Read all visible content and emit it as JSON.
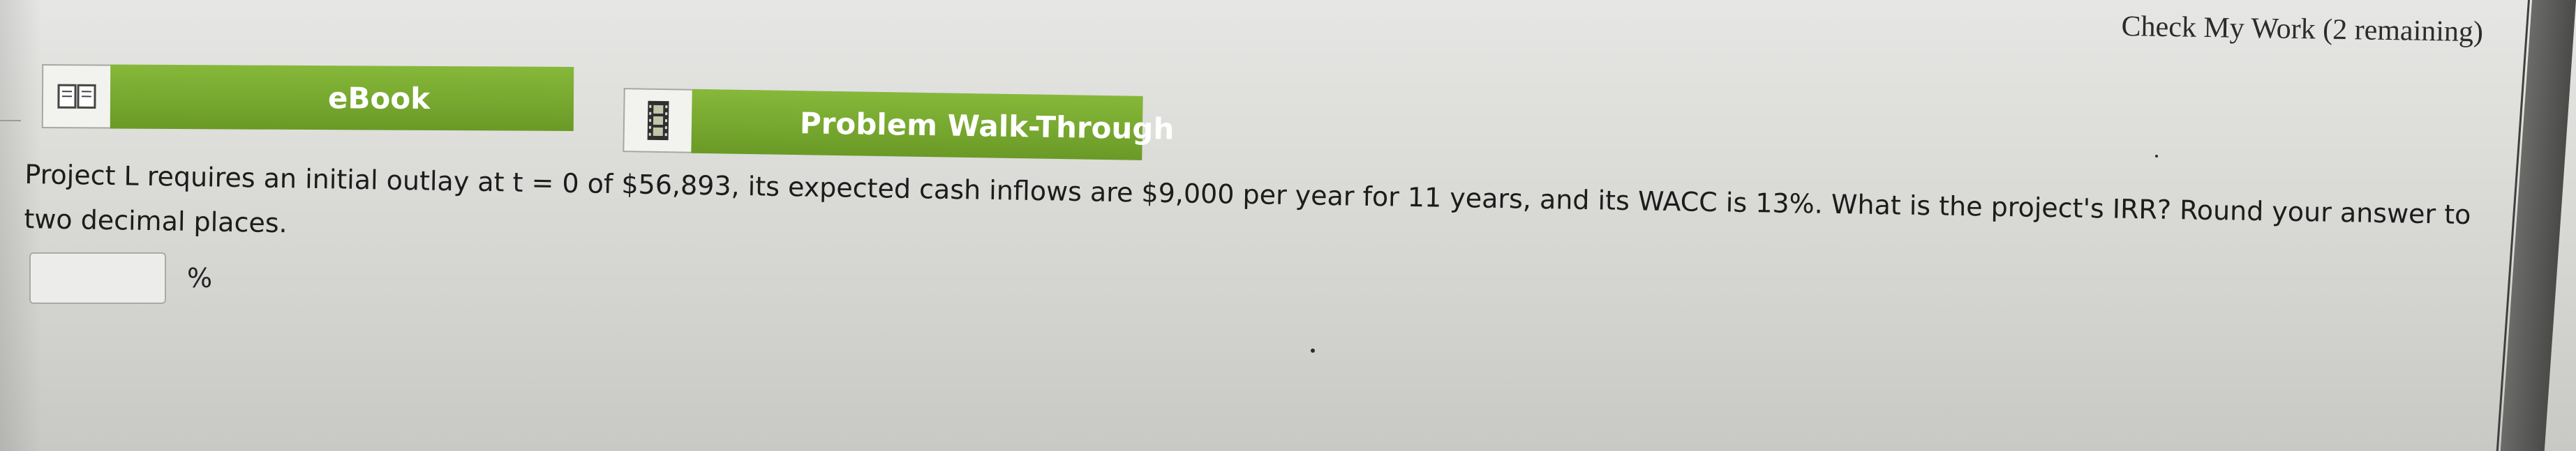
{
  "header": {
    "check_work_label": "Check My Work (2 remaining)"
  },
  "toolbar": {
    "ebook_label": "eBook",
    "ebook_icon": "book-icon",
    "walkthrough_label": "Problem Walk-Through",
    "walkthrough_icon": "film-strip-icon",
    "accent_color": "#78a82f"
  },
  "question": {
    "text": "Project L requires an initial outlay at t = 0 of $56,893, its expected cash inflows are $9,000 per year for 11 years, and its WACC is 13%. What is the project's IRR? Round your answer to two decimal places."
  },
  "answer": {
    "value": "",
    "unit": "%"
  }
}
